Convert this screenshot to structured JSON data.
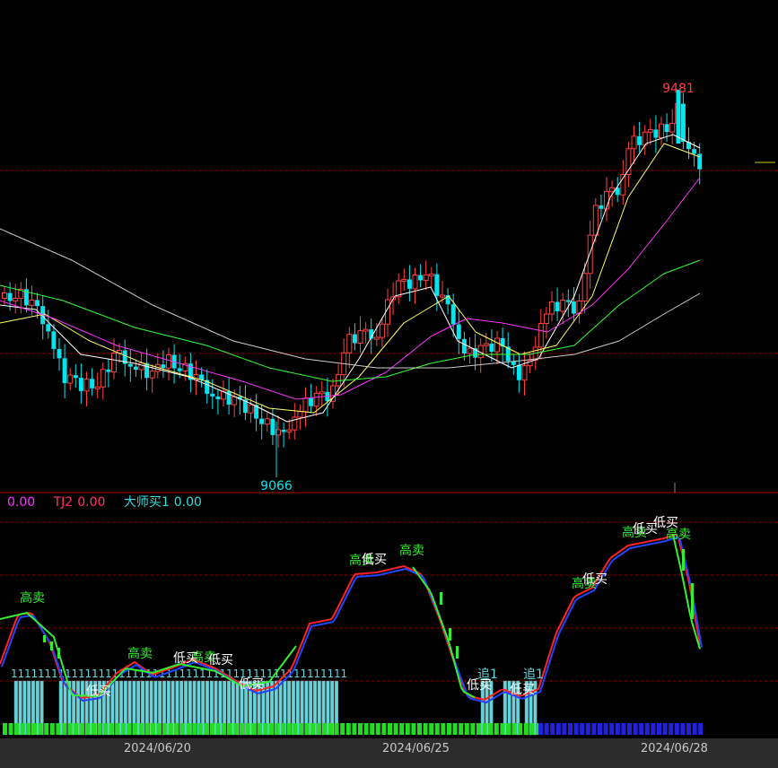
{
  "chart_data": {
    "type": "candlestick",
    "price_labels": {
      "high": "9481",
      "low": "9066"
    },
    "indicator_legend": [
      {
        "name": "",
        "value": "0.00",
        "color": "#ff33ff"
      },
      {
        "name": "TJ2",
        "value": "0.00",
        "color": "#ff3366"
      },
      {
        "name": "大师买1",
        "value": "0.00",
        "color": "#33dddd"
      }
    ],
    "x_tick_labels": [
      "2024/06/20",
      "2024/06/25",
      "2024/06/28"
    ],
    "signal_labels": {
      "sell_high": "高卖",
      "buy_low": "低买",
      "chase": "追1",
      "bar_tag": "1"
    },
    "colors": {
      "up": "#ff4040",
      "down": "#00e5ee",
      "ma5": "#ffffff",
      "ma10": "#ffff66",
      "ma20": "#ff33ff",
      "ma30": "#33ff33",
      "ma60": "#cccccc",
      "grid": "#8b0000"
    }
  }
}
